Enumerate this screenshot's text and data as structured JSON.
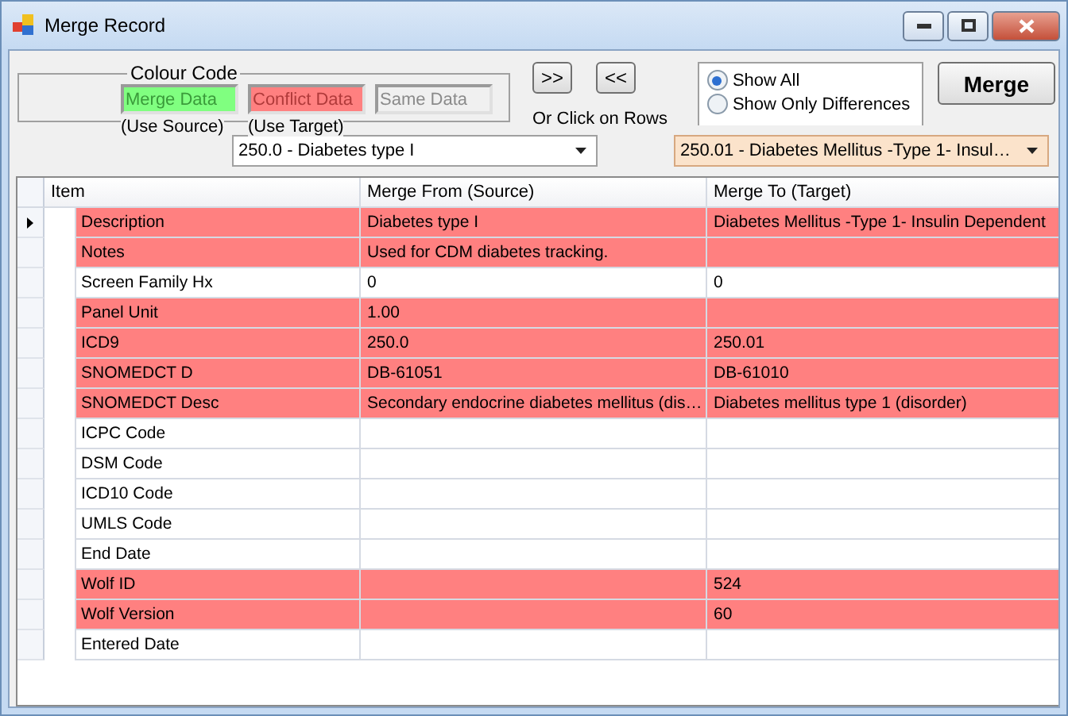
{
  "window": {
    "title": "Merge Record"
  },
  "colour_code": {
    "title": "Colour Code",
    "legend": [
      {
        "label": "Merge Data",
        "note": "(Use Source)",
        "color": "#80ff80"
      },
      {
        "label": "Conflict Data",
        "note": "(Use Target)",
        "color": "#ff8080"
      },
      {
        "label": "Same Data",
        "color": "#f0f0f0"
      }
    ]
  },
  "transfer": {
    "buttons": [
      ">>",
      "<<"
    ],
    "hint": "Or Click on Rows"
  },
  "view_options": [
    {
      "label": "Show All",
      "selected": true
    },
    {
      "label": "Show Only Differences",
      "selected": false
    }
  ],
  "merge_button": "Merge",
  "source_select": {
    "value": "250.0 - Diabetes type I",
    "focused": false
  },
  "target_select": {
    "value": "250.01 - Diabetes Mellitus -Type 1- Insul…",
    "focused": true
  },
  "table": {
    "columns": [
      "Item",
      "Merge From (Source)",
      "Merge To (Target)"
    ],
    "rows": [
      {
        "item": "Description",
        "source": "Diabetes type I",
        "target": "Diabetes Mellitus -Type 1- Insulin Dependent",
        "color": "#ff8080",
        "current": true
      },
      {
        "item": "Notes",
        "source": "Used for CDM diabetes tracking.",
        "target": "",
        "color": "#ff8080",
        "current": false
      },
      {
        "item": "Screen Family Hx",
        "source": "0",
        "target": "0",
        "color": "#ffffff",
        "current": false
      },
      {
        "item": "Panel Unit",
        "source": "1.00",
        "target": "",
        "color": "#ff8080",
        "current": false
      },
      {
        "item": "ICD9",
        "source": "250.0",
        "target": "250.01",
        "color": "#ff8080",
        "current": false
      },
      {
        "item": "SNOMEDCT D",
        "source": "DB-61051",
        "target": "DB-61010",
        "color": "#ff8080",
        "current": false
      },
      {
        "item": "SNOMEDCT Desc",
        "source": "Secondary endocrine diabetes mellitus (dis…",
        "target": "Diabetes mellitus type 1 (disorder)",
        "color": "#ff8080",
        "current": false
      },
      {
        "item": "ICPC Code",
        "source": "",
        "target": "",
        "color": "#ffffff",
        "current": false
      },
      {
        "item": "DSM Code",
        "source": "",
        "target": "",
        "color": "#ffffff",
        "current": false
      },
      {
        "item": "ICD10 Code",
        "source": "",
        "target": "",
        "color": "#ffffff",
        "current": false
      },
      {
        "item": "UMLS Code",
        "source": "",
        "target": "",
        "color": "#ffffff",
        "current": false
      },
      {
        "item": "End Date",
        "source": "",
        "target": "",
        "color": "#ffffff",
        "current": false
      },
      {
        "item": "Wolf ID",
        "source": "",
        "target": "524",
        "color": "#ff8080",
        "current": false
      },
      {
        "item": "Wolf Version",
        "source": "",
        "target": "60",
        "color": "#ff8080",
        "current": false
      },
      {
        "item": "Entered Date",
        "source": "",
        "target": "",
        "color": "#ffffff",
        "current": false
      }
    ]
  }
}
